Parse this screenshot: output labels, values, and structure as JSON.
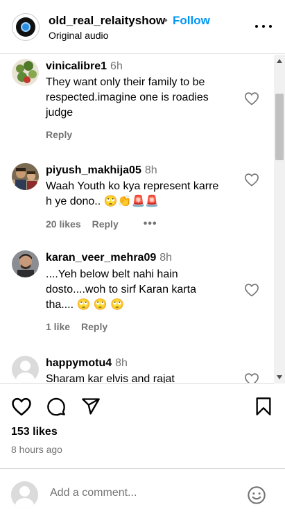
{
  "header": {
    "username": "old_real_relaityshow",
    "separator": "•",
    "follow_label": "Follow",
    "audio_label": "Original audio"
  },
  "comments": [
    {
      "username": "vinicalibre1",
      "time": "6h",
      "lines": [
        "They want only their family to be",
        "respected.imagine one is roadies",
        "judge"
      ],
      "likes": "",
      "reply": "Reply"
    },
    {
      "username": "piyush_makhija05",
      "time": "8h",
      "lines": [
        "Waah Youth ko kya represent karre",
        "h ye dono.. 🙄👏🚨🚨"
      ],
      "likes": "20 likes",
      "reply": "Reply"
    },
    {
      "username": "karan_veer_mehra09",
      "time": "8h",
      "lines": [
        "....Yeh below belt nahi hain",
        "dosto....woh to sirf Karan karta",
        "tha.... 🙄 🙄 🙄"
      ],
      "likes": "1 like",
      "reply": "Reply"
    },
    {
      "username": "happymotu4",
      "time": "8h",
      "lines": [
        "Sharam kar elvis and rajat"
      ],
      "likes": "",
      "reply": ""
    }
  ],
  "post": {
    "likes": "153 likes",
    "time_ago": "8 hours ago"
  },
  "add_comment": {
    "placeholder": "Add a comment..."
  }
}
